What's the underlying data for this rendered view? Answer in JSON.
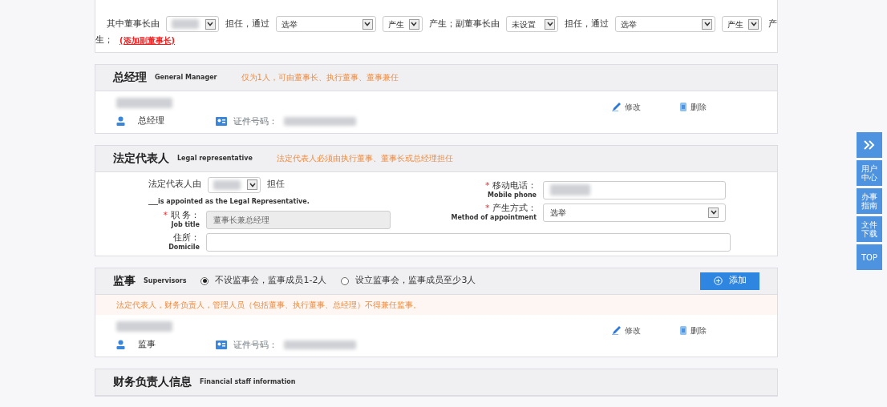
{
  "chairman_row": {
    "lines": [
      [
        {
          "kind": "text",
          "text": "其中董事长由"
        },
        {
          "kind": "blurred_select"
        },
        {
          "kind": "text",
          "text": "担任，通过"
        },
        {
          "kind": "select",
          "value": "选举"
        },
        {
          "kind": "select",
          "value": "产生"
        },
        {
          "kind": "text",
          "text": "产生；副董事长由"
        },
        {
          "kind": "select",
          "value": "未设置"
        },
        {
          "kind": "text",
          "text": "担任，通过"
        },
        {
          "kind": "select",
          "value": "选举"
        },
        {
          "kind": "select",
          "value": "产生"
        },
        {
          "kind": "text",
          "text": "产"
        }
      ],
      [
        {
          "kind": "text",
          "text": "生；"
        },
        {
          "kind": "link",
          "text": "(添加副董事长)"
        }
      ]
    ]
  },
  "general_manager": {
    "title": "总经理",
    "subtitle": "General Manager",
    "note": "仅为1人，可由董事长、执行董事、董事兼任",
    "people": [
      {
        "role": "总经理",
        "id_label": "证件号码：",
        "edit": "修改",
        "delete": "删除"
      }
    ]
  },
  "legal_rep": {
    "title": "法定代表人",
    "subtitle": "Legal representative",
    "note": "法定代表人必须由执行董事、董事长或总经理担任",
    "appoint_prefix": "法定代表人由",
    "appoint_suffix": "担任",
    "appoint_en": "___is appointed as the Legal Representative.",
    "job": {
      "mark": "*",
      "label": "职 务：",
      "en": "Job title",
      "value": "董事长兼总经理"
    },
    "mobile": {
      "mark": "*",
      "label": "移动电话：",
      "en": "Mobile phone"
    },
    "method": {
      "mark": "*",
      "label": "产生方式：",
      "en": "Method of appointment",
      "value": "选举"
    },
    "domicile": {
      "label": "住所：",
      "en": "Domicile"
    }
  },
  "supervisors": {
    "title": "监事",
    "subtitle": "Supervisors",
    "options": [
      {
        "label": "不设监事会，监事成员1-2人",
        "selected": true
      },
      {
        "label": "设立监事会，监事成员至少3人",
        "selected": false
      }
    ],
    "add_button": "添加",
    "note": "法定代表人，财务负责人，管理人员（包括董事、执行董事、总经理）不得兼任监事。",
    "people": [
      {
        "role": "监事",
        "id_label": "证件号码：",
        "edit": "修改",
        "delete": "删除"
      }
    ]
  },
  "financial": {
    "title": "财务负责人信息",
    "subtitle": "Financial staff information"
  },
  "sidebar": [
    {
      "kind": "expand"
    },
    {
      "kind": "text",
      "text": "用户中心"
    },
    {
      "kind": "text",
      "text": "办事指南"
    },
    {
      "kind": "text",
      "text": "文件下载"
    },
    {
      "kind": "text",
      "text": "TOP"
    }
  ]
}
